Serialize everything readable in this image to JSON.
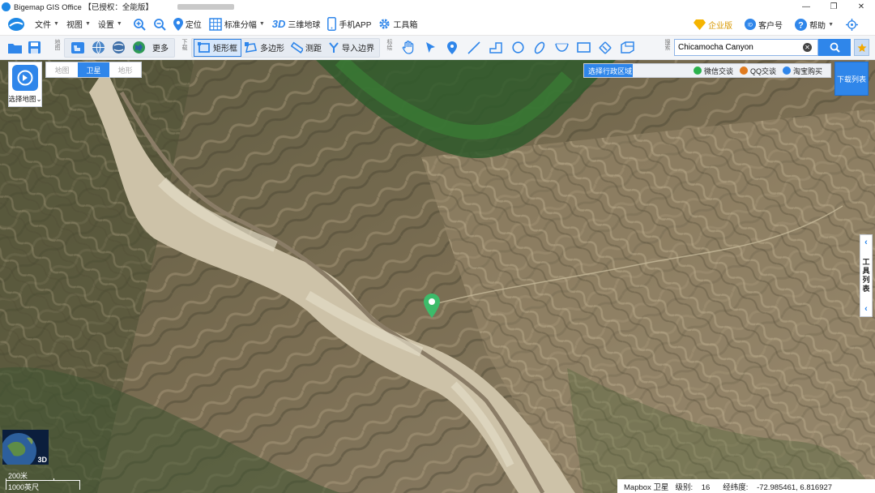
{
  "window": {
    "title": "Bigemap GIS Office 【已授权：全能版】",
    "controls": [
      "minimize",
      "restore",
      "close"
    ]
  },
  "menu": {
    "items": [
      {
        "label": "文件",
        "icon": "file-icon",
        "dropdown": true
      },
      {
        "label": "视图",
        "icon": "",
        "dropdown": true
      },
      {
        "label": "设置",
        "icon": "",
        "dropdown": true
      }
    ],
    "tools": [
      {
        "label": "",
        "icon": "zoom-in-icon"
      },
      {
        "label": "",
        "icon": "zoom-out-icon"
      },
      {
        "label": "定位",
        "icon": "location-icon"
      },
      {
        "label": "标准分幅",
        "icon": "grid-icon",
        "dropdown": true
      },
      {
        "label": "三维地球",
        "icon": "3d-icon",
        "badge": "3D"
      },
      {
        "label": "手机APP",
        "icon": "phone-icon"
      },
      {
        "label": "工具箱",
        "icon": "toolbox-icon"
      }
    ],
    "right": [
      {
        "label": "企业版",
        "icon": "enterprise-icon"
      },
      {
        "label": "客户号",
        "icon": "customer-icon"
      },
      {
        "label": "帮助",
        "icon": "help-icon",
        "dropdown": true
      },
      {
        "label": "",
        "icon": "target-icon"
      }
    ]
  },
  "toolbar": {
    "map_group_label": "地图",
    "more_label": "更多",
    "download_group_label": "下载",
    "download_items": [
      {
        "label": "矩形框",
        "icon": "rectangle-select-icon",
        "selected": true
      },
      {
        "label": "多边形",
        "icon": "polygon-select-icon"
      },
      {
        "label": "测距",
        "icon": "measure-icon"
      },
      {
        "label": "导入边界",
        "icon": "import-boundary-icon"
      }
    ],
    "mark_group_label": "标绘",
    "search_group_label": "搜索",
    "search_value": "Chicamocha Canyon"
  },
  "map_panel": {
    "select_map_label": "选择地图",
    "tabs": [
      {
        "label": "地图",
        "active": false
      },
      {
        "label": "卫星",
        "active": true
      },
      {
        "label": "地形",
        "active": false
      }
    ],
    "region_select_label": "选择行政区域",
    "region_buttons": [
      {
        "label": "微信交谈",
        "color": "#2bb24c"
      },
      {
        "label": "QQ交谈",
        "color": "#e07b1f"
      },
      {
        "label": "淘宝购买",
        "color": "#2f86ea"
      }
    ],
    "download_list_label": "下载列表",
    "tool_list_label": "工具列表",
    "minimap_label": "3D"
  },
  "scale": {
    "metric": "200米",
    "imperial": "1000英尺"
  },
  "status": {
    "source": "Mapbox 卫星",
    "zoom_label": "级别:",
    "zoom": "16",
    "coord_label": "经纬度:",
    "coords": "-72.985461, 6.816927"
  },
  "colors": {
    "accent": "#2f86ea",
    "pin": "#3dbb6a"
  }
}
